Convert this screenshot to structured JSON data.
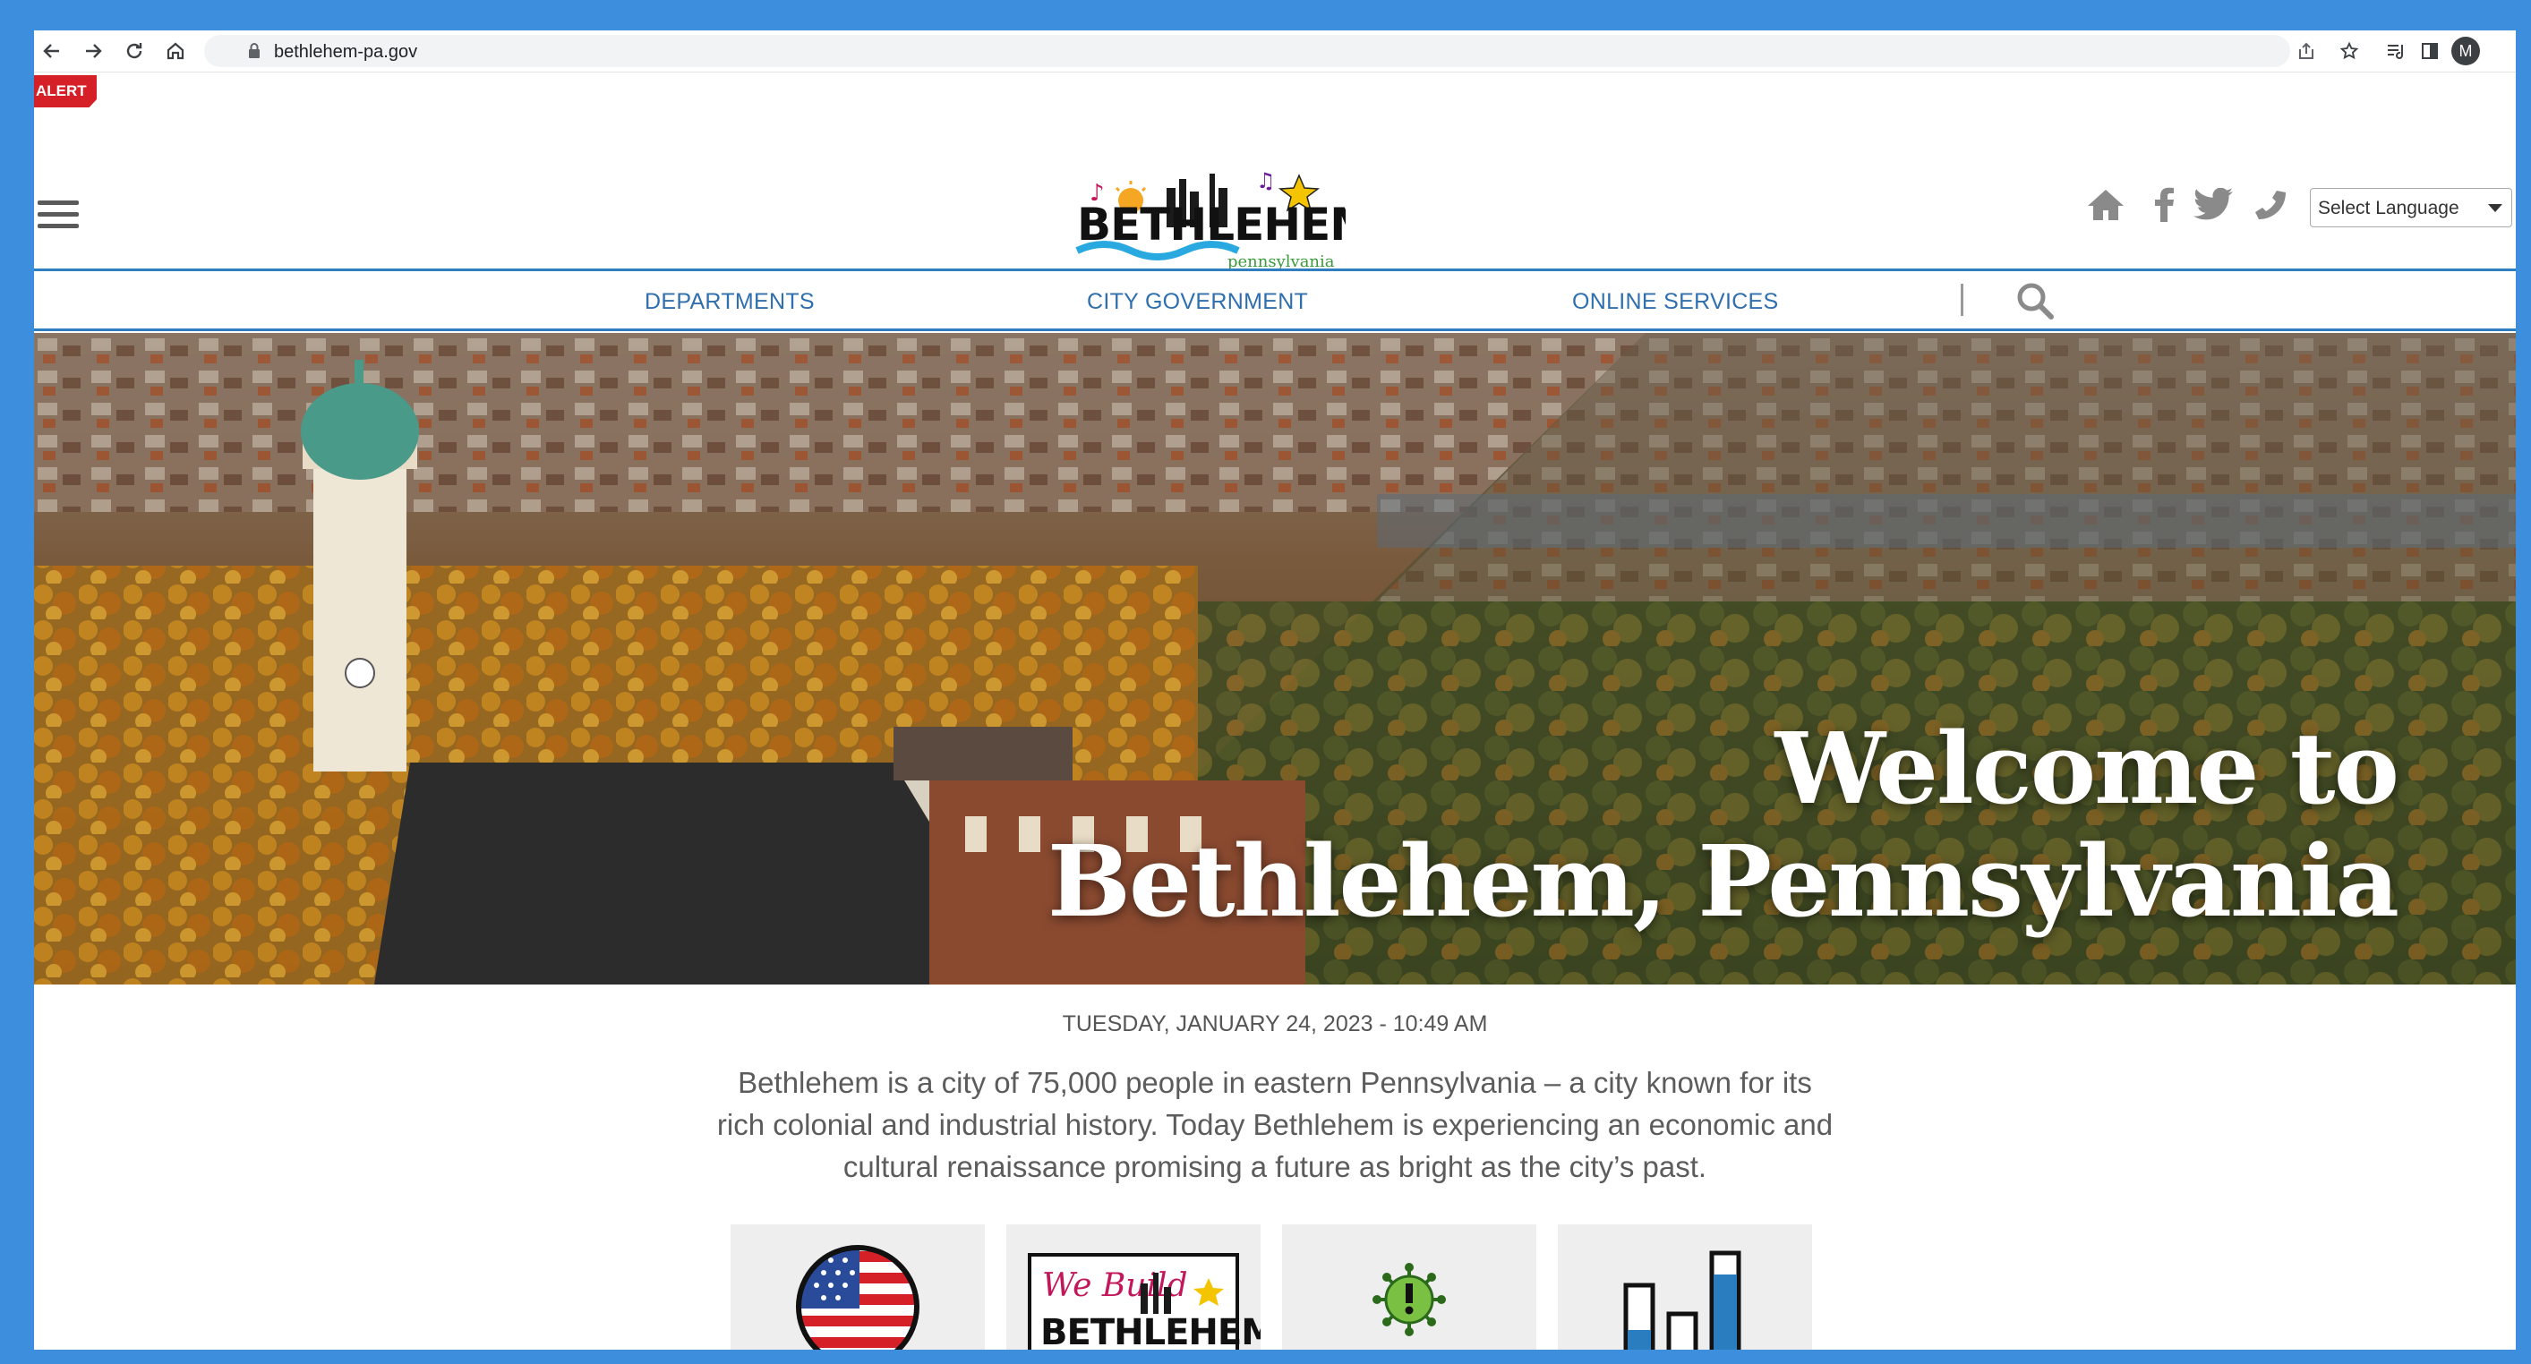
{
  "browser": {
    "url": "bethlehem-pa.gov",
    "avatar_initial": "M"
  },
  "alert": {
    "label": "ALERT",
    "color": "#d62027"
  },
  "header": {
    "logo_text": "BETHLEHEM",
    "logo_sub": "pennsylvania",
    "social_icons": [
      "home-icon",
      "facebook-icon",
      "twitter-icon",
      "phone-icon"
    ],
    "language_select": "Select Language"
  },
  "nav": {
    "items": [
      "DEPARTMENTS",
      "CITY GOVERNMENT",
      "ONLINE SERVICES"
    ],
    "accent": "#2f7ec0"
  },
  "hero": {
    "title_line1": "Welcome to",
    "title_line2": "Bethlehem, Pennsylvania"
  },
  "content": {
    "datetime": "TUESDAY, JANUARY 24, 2023 - 10:49 AM",
    "intro": "Bethlehem is a city of 75,000 people in eastern Pennsylvania – a city known for its rich colonial and industrial history. Today Bethlehem is experiencing an economic and cultural renaissance promising a future as bright as the city’s past."
  },
  "tiles": [
    {
      "icon": "american-flag-icon"
    },
    {
      "icon": "we-build-bethlehem-logo",
      "logo_text": "We Build BETHLEHEM"
    },
    {
      "icon": "virus-alert-icon"
    },
    {
      "icon": "bar-chart-icon"
    }
  ]
}
